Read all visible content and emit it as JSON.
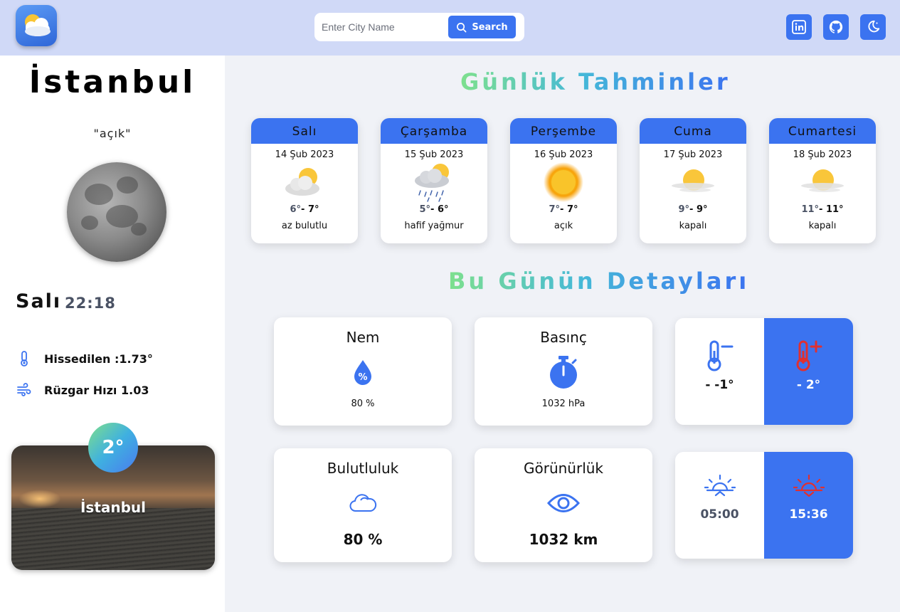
{
  "header": {
    "search_placeholder": "Enter City Name",
    "search_label": "Search",
    "buttons": [
      "linkedin-icon",
      "github-icon",
      "dark-mode-icon"
    ]
  },
  "sidebar": {
    "city": "İstanbul",
    "description": "\"açık\"",
    "day": "Salı",
    "time": "22:18",
    "feels_like": "Hissedilen :1.73°",
    "wind": "Rüzgar Hızı 1.03",
    "card_temp": "2°",
    "card_city": "İstanbul"
  },
  "forecast": {
    "title": "Günlük Tahminler",
    "days": [
      {
        "day": "Salı",
        "date": "14 Şub 2023",
        "lo": "6°",
        "hi": "- 7°",
        "desc": "az bulutlu",
        "icon": "partly-cloudy-icon"
      },
      {
        "day": "Çarşamba",
        "date": "15 Şub 2023",
        "lo": "5°",
        "hi": "- 6°",
        "desc": "hafif yağmur",
        "icon": "rain-icon"
      },
      {
        "day": "Perşembe",
        "date": "16 Şub 2023",
        "lo": "7°",
        "hi": "- 7°",
        "desc": "açık",
        "icon": "sun-icon"
      },
      {
        "day": "Cuma",
        "date": "17 Şub 2023",
        "lo": "9°",
        "hi": "- 9°",
        "desc": "kapalı",
        "icon": "hazy-sun-icon"
      },
      {
        "day": "Cumartesi",
        "date": "18 Şub 2023",
        "lo": "11°",
        "hi": "- 11°",
        "desc": "kapalı",
        "icon": "hazy-sun-icon"
      }
    ]
  },
  "details": {
    "title": "Bu Günün Detayları",
    "humidity": {
      "title": "Nem",
      "value": "80 %"
    },
    "pressure": {
      "title": "Basınç",
      "value": "1032 hPa"
    },
    "clouds": {
      "title": "Bulutluluk",
      "value": "80 %"
    },
    "visibility": {
      "title": "Görünürlük",
      "value": "1032 km"
    },
    "temp_min": "- -1°",
    "temp_max": "- 2°",
    "sunrise": "05:00",
    "sunset": "15:36"
  },
  "colors": {
    "accent": "#3b73f0",
    "header": "#d0d9f7",
    "hot": "#e03030"
  }
}
